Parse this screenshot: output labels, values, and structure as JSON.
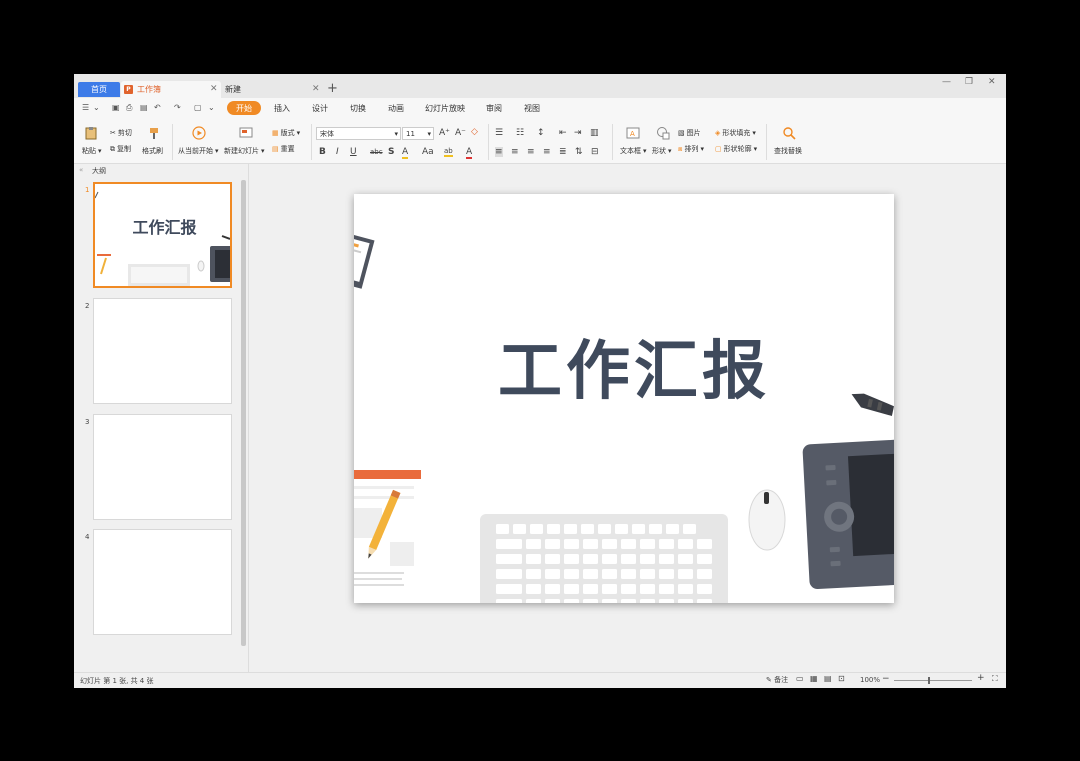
{
  "tabs": {
    "home": "首页",
    "doc": "工作簿",
    "doc_icon": "P",
    "new": "新建",
    "plus": "+"
  },
  "window_controls": {
    "minimize": "—",
    "restore": "❐",
    "close": "✕"
  },
  "menu": {
    "hamburger": "☰",
    "start": "开始",
    "items": [
      "插入",
      "设计",
      "切换",
      "动画",
      "幻灯片放映",
      "审阅",
      "视图"
    ]
  },
  "ribbon": {
    "paste": "粘贴",
    "cut": "剪切",
    "copy": "复制",
    "format_painter": "格式刷",
    "play_from_current": "从当前开始",
    "new_slide": "新建幻灯片",
    "layout": "版式",
    "reset": "重置",
    "font_name": "宋体",
    "font_size": "11",
    "textbox": "文本框",
    "shape": "形状",
    "picture": "图片",
    "arrange": "排列",
    "shape_fill": "形状填充",
    "shape_outline": "形状轮廓",
    "find_replace": "查找替换"
  },
  "outline_label": "大纲",
  "slides": [
    {
      "number": "1",
      "title": "工作汇报"
    },
    {
      "number": "2",
      "title": ""
    },
    {
      "number": "3",
      "title": ""
    },
    {
      "number": "4",
      "title": ""
    }
  ],
  "main_slide": {
    "title": "工作汇报"
  },
  "status": {
    "slide_info": "幻灯片 第 1 张, 共 4 张",
    "notes": "备注",
    "zoom": "100%"
  },
  "colors": {
    "accent": "#f08a24",
    "home_tab": "#3d7be8",
    "title_text": "#3f4a5c",
    "ppt_icon": "#e0632c"
  }
}
